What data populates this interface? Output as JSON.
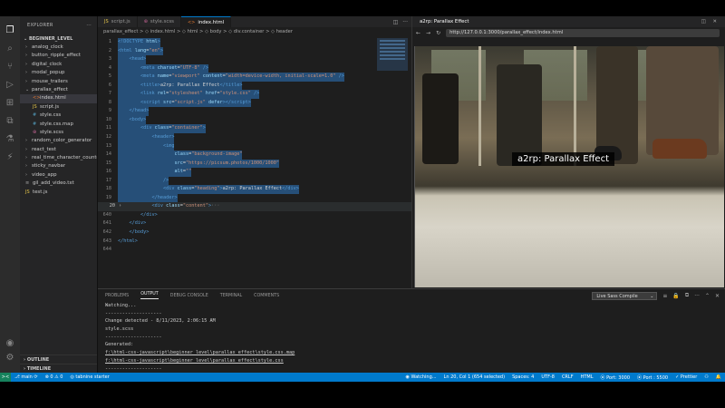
{
  "sidebar": {
    "title": "EXPLORER",
    "more": "···",
    "root": "BEGINNER_LEVEL",
    "items": [
      {
        "label": "analog_clock",
        "type": "folder",
        "depth": 1
      },
      {
        "label": "button_ripple_effect",
        "type": "folder",
        "depth": 1
      },
      {
        "label": "digital_clock",
        "type": "folder",
        "depth": 1
      },
      {
        "label": "modal_popup",
        "type": "folder",
        "depth": 1
      },
      {
        "label": "mouse_trailers",
        "type": "folder",
        "depth": 1
      },
      {
        "label": "parallax_effect",
        "type": "folder-open",
        "depth": 1
      },
      {
        "label": "index.html",
        "type": "html",
        "depth": 2,
        "selected": true
      },
      {
        "label": "script.js",
        "type": "js",
        "depth": 2
      },
      {
        "label": "style.css",
        "type": "css",
        "depth": 2
      },
      {
        "label": "style.css.map",
        "type": "map",
        "depth": 2
      },
      {
        "label": "style.scss",
        "type": "scss",
        "depth": 2
      },
      {
        "label": "random_color_generator",
        "type": "folder",
        "depth": 1
      },
      {
        "label": "react_test",
        "type": "folder",
        "depth": 1
      },
      {
        "label": "real_time_character_counter",
        "type": "folder",
        "depth": 1
      },
      {
        "label": "sticky_navbar",
        "type": "folder",
        "depth": 1
      },
      {
        "label": "video_app",
        "type": "folder",
        "depth": 1
      },
      {
        "label": "gil_add_video.txt",
        "type": "txt",
        "depth": 1
      },
      {
        "label": "test.js",
        "type": "js",
        "depth": 1
      }
    ],
    "outline": "OUTLINE",
    "timeline": "TIMELINE"
  },
  "editor": {
    "tabs": [
      {
        "label": "script.js",
        "icon": "JS",
        "color": "#e8c84a",
        "active": false
      },
      {
        "label": "style.scss",
        "icon": "⊛",
        "color": "#cd6799",
        "active": false
      },
      {
        "label": "index.html",
        "icon": "<>",
        "color": "#e37933",
        "active": true
      }
    ],
    "breadcrumb": "parallax_effect  >  ◇ index.html  >  ◇ html  >  ◇ body  >  ◇ div.container  >  ◇ header",
    "lines": [
      {
        "n": "1",
        "html": "<span class='t-tag'>&lt;!DOCTYPE</span> <span class='t-attr'>html</span><span class='t-tag'>&gt;</span>"
      },
      {
        "n": "2",
        "html": "<span class='t-tag'>&lt;html</span> <span class='t-attr'>lang</span>=<span class='t-str'>\"en\"</span><span class='t-tag'>&gt;</span>"
      },
      {
        "n": "3",
        "html": "    <span class='t-tag'>&lt;head&gt;</span>"
      },
      {
        "n": "4",
        "html": "        <span class='t-tag'>&lt;meta</span> <span class='t-attr'>charset</span>=<span class='t-str'>\"UTF-8\"</span> <span class='t-tag'>/&gt;</span>"
      },
      {
        "n": "5",
        "html": "        <span class='t-tag'>&lt;meta</span> <span class='t-attr'>name</span>=<span class='t-str'>\"viewport\"</span> <span class='t-attr'>content</span>=<span class='t-str'>\"width=device-width, initial-scale=1.0\"</span> <span class='t-tag'>/&gt;</span>"
      },
      {
        "n": "6",
        "html": "        <span class='t-tag'>&lt;title&gt;</span>a2rp: Parallax Effect<span class='t-tag'>&lt;/title&gt;</span>"
      },
      {
        "n": "7",
        "html": "        <span class='t-tag'>&lt;link</span> <span class='t-attr'>rel</span>=<span class='t-str'>\"stylesheet\"</span> <span class='t-attr'>href</span>=<span class='t-str'>\"style.css\"</span> <span class='t-tag'>/&gt;</span>"
      },
      {
        "n": "8",
        "html": "        <span class='t-tag'>&lt;script</span> <span class='t-attr'>src</span>=<span class='t-str'>\"script.js\"</span> <span class='t-attr'>defer</span><span class='t-tag'>&gt;&lt;/script&gt;</span>"
      },
      {
        "n": "9",
        "html": "    <span class='t-tag'>&lt;/head&gt;</span>"
      },
      {
        "n": "10",
        "html": "    <span class='t-tag'>&lt;body&gt;</span>"
      },
      {
        "n": "11",
        "html": "        <span class='t-tag'>&lt;div</span> <span class='t-attr'>class</span>=<span class='t-str'>\"container\"</span><span class='t-tag'>&gt;</span>"
      },
      {
        "n": "12",
        "html": "            <span class='t-tag'>&lt;header&gt;</span>"
      },
      {
        "n": "13",
        "html": "                <span class='t-tag'>&lt;img</span>"
      },
      {
        "n": "14",
        "html": "                    <span class='t-attr'>class</span>=<span class='t-str'>\"background-image\"</span>"
      },
      {
        "n": "15",
        "html": "                    <span class='t-attr'>src</span>=<span class='t-str'>\"https://picsum.photos/1000/1000\"</span>"
      },
      {
        "n": "16",
        "html": "                    <span class='t-attr'>alt</span>=<span class='t-str'>\"\"</span>"
      },
      {
        "n": "17",
        "html": "                <span class='t-tag'>/&gt;</span>"
      },
      {
        "n": "18",
        "html": "                <span class='t-tag'>&lt;div</span> <span class='t-attr'>class</span>=<span class='t-str'>\"heading\"</span><span class='t-tag'>&gt;</span>a2rp: Parallax Effect<span class='t-tag'>&lt;/div&gt;</span>"
      },
      {
        "n": "19",
        "html": "            <span class='t-tag'>&lt;/header&gt;</span>"
      },
      {
        "n": "20",
        "html": "            <span class='t-tag'>&lt;div</span> <span class='t-attr'>class</span>=<span class='t-str'>\"content\"</span><span class='t-tag'>&gt;</span><span class='t-com'>···</span>"
      },
      {
        "n": "640",
        "html": "        <span class='t-tag'>&lt;/div&gt;</span>"
      },
      {
        "n": "641",
        "html": "    <span class='t-tag'>&lt;/div&gt;</span>"
      },
      {
        "n": "642",
        "html": "    <span class='t-tag'>&lt;/body&gt;</span>"
      },
      {
        "n": "643",
        "html": "<span class='t-tag'>&lt;/html&gt;</span>"
      },
      {
        "n": "644",
        "html": ""
      }
    ]
  },
  "browser": {
    "title": "a2rp: Parallax Effect",
    "url": "http://127.0.0.1:3000/parallax_effect/index.html",
    "heading": "a2rp: Parallax Effect"
  },
  "panel": {
    "tabs": [
      "PROBLEMS",
      "OUTPUT",
      "DEBUG CONSOLE",
      "TERMINAL",
      "COMMENTS"
    ],
    "active_tab": "OUTPUT",
    "channel": "Live Sass Compile",
    "output": [
      {
        "text": "Watching...",
        "link": false
      },
      {
        "text": "--------------------",
        "link": false
      },
      {
        "text": "Change detected - 8/11/2023, 2:06:15 AM",
        "link": false
      },
      {
        "text": "style.scss",
        "link": false
      },
      {
        "text": "--------------------",
        "link": false
      },
      {
        "text": "Generated:",
        "link": false
      },
      {
        "text": "f:\\html-css-javascript\\beginner_level\\parallax_effect\\style.css.map",
        "link": true
      },
      {
        "text": "f:\\html-css-javascript\\beginner_level\\parallax_effect\\style.css",
        "link": true
      },
      {
        "text": "--------------------",
        "link": false
      },
      {
        "text": "Watching...",
        "link": false
      },
      {
        "text": "--------------------",
        "link": false
      }
    ]
  },
  "status": {
    "remote": "><",
    "branch": "⎇ main ⟳",
    "problems": "⊗ 0  ⚠ 0",
    "tabnine": "◎ tabnine starter",
    "right": [
      "◉ Watching...",
      "Ln 20, Col 1 (654 selected)",
      "Spaces: 4",
      "UTF-8",
      "CRLF",
      "HTML",
      "⦿ Port: 3000",
      "⦿ Port : 5500",
      "✓ Prettier",
      "⚇",
      "🔔"
    ]
  }
}
